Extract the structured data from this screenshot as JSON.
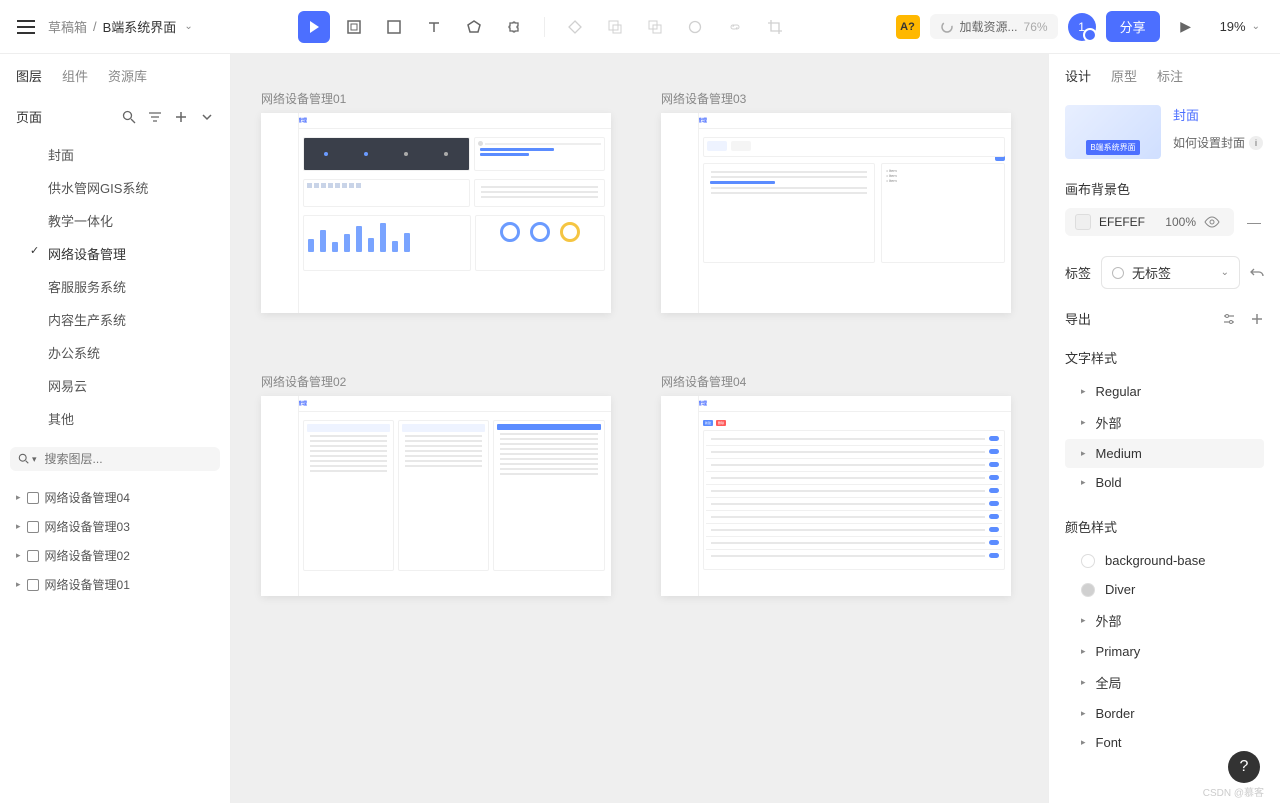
{
  "breadcrumb": {
    "folder": "草稿箱",
    "project": "B端系统界面"
  },
  "topbar": {
    "badge": "A?",
    "loading_label": "加载资源...",
    "loading_pct": "76%",
    "avatar": "1",
    "share": "分享",
    "zoom": "19%"
  },
  "left_tabs": [
    "图层",
    "组件",
    "资源库"
  ],
  "left_tabs_active": 0,
  "pages_header": "页面",
  "pages": [
    "封面",
    "供水管网GIS系统",
    "教学一体化",
    "网络设备管理",
    "客服服务系统",
    "内容生产系统",
    "办公系统",
    "网易云",
    "其他"
  ],
  "pages_active": 3,
  "layer_search_placeholder": "搜索图层...",
  "layers": [
    "网络设备管理04",
    "网络设备管理03",
    "网络设备管理02",
    "网络设备管理01"
  ],
  "artboards": [
    "网络设备管理01",
    "网络设备管理03",
    "网络设备管理02",
    "网络设备管理04"
  ],
  "artboard_title": "网络设备管理",
  "right_tabs": [
    "设计",
    "原型",
    "标注"
  ],
  "right_tabs_active": 0,
  "cover": {
    "link": "封面",
    "howto": "如何设置封面",
    "thumb_label": "B端系统界面"
  },
  "bg": {
    "title": "画布背景色",
    "hex": "EFEFEF",
    "opacity": "100%"
  },
  "tag": {
    "title": "标签",
    "value": "无标签"
  },
  "export": {
    "title": "导出"
  },
  "text_styles": {
    "title": "文字样式",
    "items": [
      "Regular",
      "外部",
      "Medium",
      "Bold"
    ],
    "selected": 2
  },
  "color_styles": {
    "title": "颜色样式",
    "swatches": [
      {
        "name": "background-base",
        "kind": "dot",
        "class": "base"
      },
      {
        "name": "Diver",
        "kind": "dot",
        "class": "diver"
      }
    ],
    "groups": [
      "外部",
      "Primary",
      "全局",
      "Border",
      "Font"
    ]
  },
  "watermark": "CSDN @慕客"
}
